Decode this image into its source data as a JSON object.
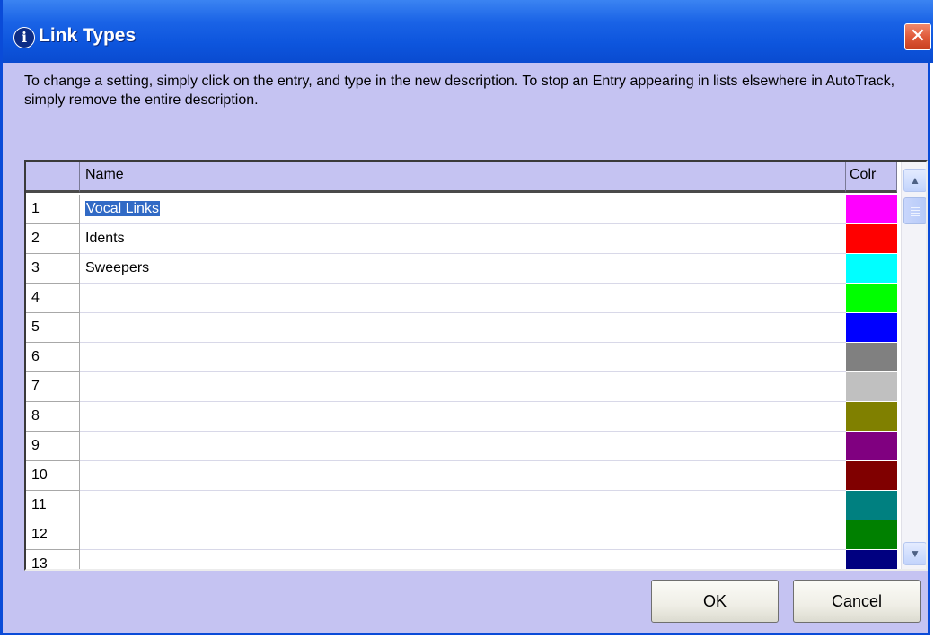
{
  "window": {
    "title": "Link Types",
    "close_glyph": "✕",
    "info_glyph": "i"
  },
  "description": "To change a setting, simply click on the entry, and type in the new description. To stop an Entry appearing in lists elsewhere in AutoTrack, simply remove the entire description.",
  "grid": {
    "columns": [
      "",
      "Name",
      "Colr"
    ],
    "rows": [
      {
        "num": "1",
        "name": "Vocal Links",
        "color": "#ff00ff",
        "selected": true
      },
      {
        "num": "2",
        "name": "Idents",
        "color": "#ff0000"
      },
      {
        "num": "3",
        "name": "Sweepers",
        "color": "#00ffff"
      },
      {
        "num": "4",
        "name": "",
        "color": "#00ff00"
      },
      {
        "num": "5",
        "name": "",
        "color": "#0000ff"
      },
      {
        "num": "6",
        "name": "",
        "color": "#808080"
      },
      {
        "num": "7",
        "name": "",
        "color": "#c0c0c0"
      },
      {
        "num": "8",
        "name": "",
        "color": "#808000"
      },
      {
        "num": "9",
        "name": "",
        "color": "#800080"
      },
      {
        "num": "10",
        "name": "",
        "color": "#800000"
      },
      {
        "num": "11",
        "name": "",
        "color": "#008080"
      },
      {
        "num": "12",
        "name": "",
        "color": "#008000"
      },
      {
        "num": "13",
        "name": "",
        "color": "#000080"
      }
    ]
  },
  "buttons": {
    "ok": "OK",
    "cancel": "Cancel"
  },
  "colors": {
    "dialog_bg": "#c5c3f2",
    "titlebar": "#0d55dd",
    "selection": "#316ac5"
  }
}
